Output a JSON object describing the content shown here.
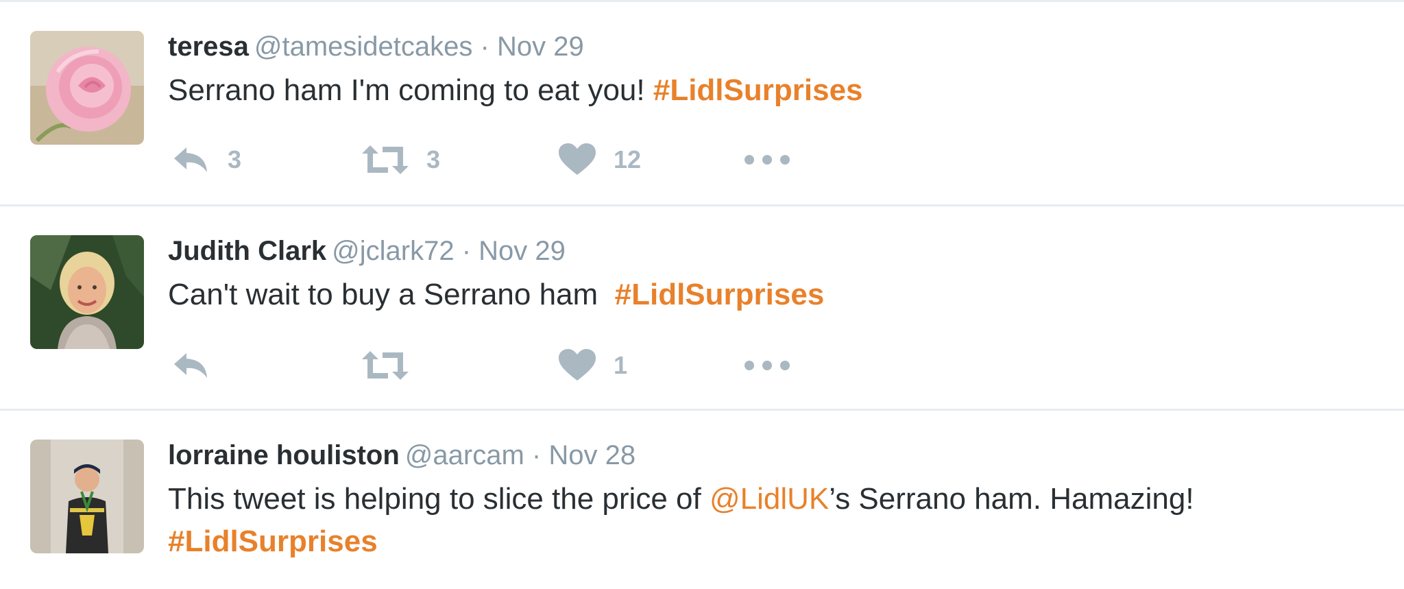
{
  "tweets": [
    {
      "name": "teresa",
      "handle": "@tamesidetcakes",
      "separator": "·",
      "date": "Nov 29",
      "text_before": "Serrano ham I'm coming to eat you! ",
      "hashtag": "#LidlSurprises",
      "replies": "3",
      "retweets": "3",
      "likes": "12",
      "avatar_icon": "pink-rose-avatar"
    },
    {
      "name": "Judith Clark",
      "handle": "@jclark72",
      "separator": "·",
      "date": "Nov 29",
      "text_before": "Can't wait to buy a Serrano ham  ",
      "hashtag": "#LidlSurprises",
      "replies": "",
      "retweets": "",
      "likes": "1",
      "avatar_icon": "woman-portrait-avatar"
    },
    {
      "name": "lorraine houliston",
      "handle": "@aarcam",
      "separator": "·",
      "date": "Nov 28",
      "text_before": "This tweet is helping to slice the price of ",
      "mention": "@LidlUK",
      "text_after": "’s Serrano ham. Hamazing!",
      "hashtag": "#LidlSurprises",
      "avatar_icon": "boy-with-trophy-avatar"
    }
  ],
  "icons": {
    "reply": "reply-icon",
    "retweet": "retweet-icon",
    "like": "heart-icon",
    "more": "more-dots-icon"
  },
  "colors": {
    "accent": "#e8812b",
    "muted": "#8899a6",
    "action": "#aab8c2",
    "text": "#292f33",
    "divider": "#e6ecf0"
  }
}
